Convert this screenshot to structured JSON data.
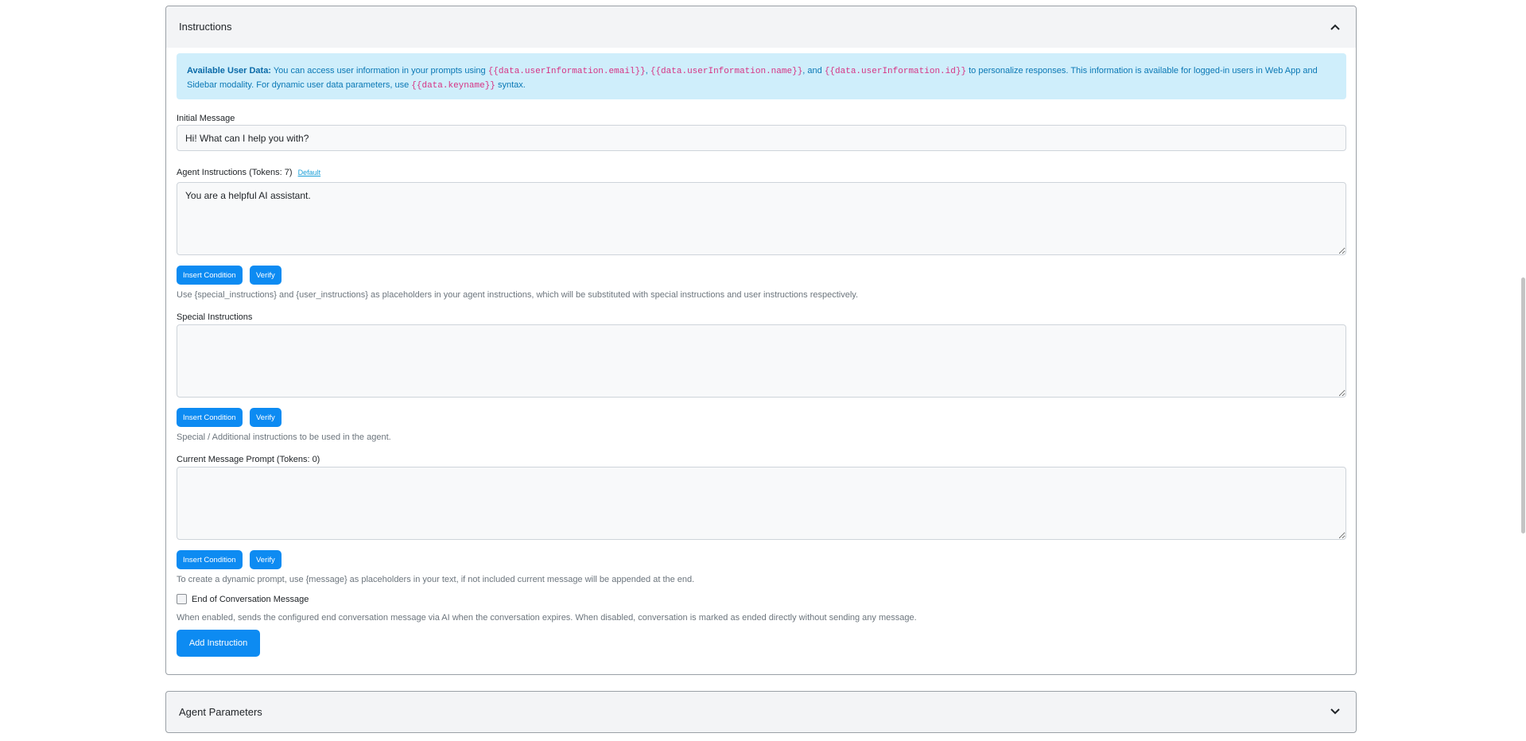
{
  "instructions_panel": {
    "title": "Instructions",
    "alert": {
      "lead": "Available User Data:",
      "text1": " You can access user information in your prompts using ",
      "code1": "{{data.userInformation.email}}",
      "sep1": ", ",
      "code2": "{{data.userInformation.name}}",
      "sep2": ", and ",
      "code3": "{{data.userInformation.id}}",
      "text2": " to personalize responses. This information is available for logged-in users in Web App and Sidebar modality. For dynamic user data parameters, use ",
      "code4": "{{data.keyname}}",
      "text3": " syntax."
    },
    "initial_message": {
      "label": "Initial Message",
      "value": "Hi! What can I help you with?"
    },
    "agent_instructions": {
      "label": "Agent Instructions (Tokens: 7)",
      "default_link": "Default",
      "value": "You are a helpful AI assistant.",
      "insert_condition": "Insert Condition",
      "verify": "Verify",
      "help": "Use {special_instructions} and {user_instructions} as placeholders in your agent instructions, which will be substituted with special instructions and user instructions respectively."
    },
    "special_instructions": {
      "label": "Special Instructions",
      "value": "",
      "insert_condition": "Insert Condition",
      "verify": "Verify",
      "help": "Special / Additional instructions to be used in the agent."
    },
    "current_message_prompt": {
      "label": "Current Message Prompt (Tokens: 0)",
      "value": "",
      "insert_condition": "Insert Condition",
      "verify": "Verify",
      "help": "To create a dynamic prompt, use {message} as placeholders in your text, if not included current message will be appended at the end."
    },
    "end_of_conversation": {
      "label": "End of Conversation Message",
      "checked": false,
      "help": "When enabled, sends the configured end conversation message via AI when the conversation expires. When disabled, conversation is marked as ended directly without sending any message."
    },
    "add_instruction": "Add Instruction"
  },
  "agent_parameters_panel": {
    "title": "Agent Parameters"
  },
  "icons": {
    "collapse": "chevron-up-icon",
    "expand": "chevron-down-icon"
  },
  "colors": {
    "primary": "#0d8bf2",
    "alert_bg": "#cfeefb",
    "code": "#d63384"
  }
}
